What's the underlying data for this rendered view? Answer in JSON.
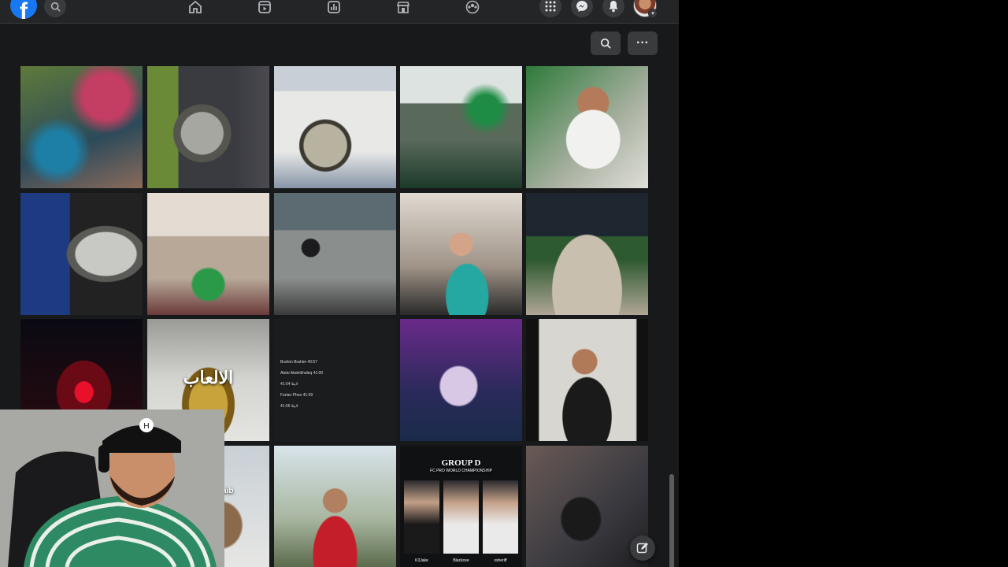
{
  "nav": {
    "logo_text": "f",
    "icons": [
      "search-icon",
      "home-icon",
      "reels-icon",
      "stats-icon",
      "marketplace-icon",
      "groups-icon",
      "apps-grid-icon",
      "messenger-icon",
      "bell-icon"
    ]
  },
  "toolbar": {
    "icons": [
      "search-icon",
      "more-icon"
    ],
    "more_label": "···"
  },
  "grid": {
    "rows": 4,
    "columns": 5,
    "captions": {
      "arabic_title": "الالعاب",
      "gamsi_handle": "gamsi choaib",
      "group_title": "GROUP D",
      "group_subtitle": "FC PRO WORLD CHAMPIONSHIP",
      "players": [
        "K3Jake",
        "Blackcee",
        "xsheriff"
      ],
      "chat_names": [
        "Brahim Brahim 40:57",
        "Abdo Abdelkhaleq 41:00",
        "لابيلا 41:04",
        "Forian Phoo 41:09",
        "لابيلا 41:06"
      ]
    }
  },
  "colors": {
    "facebook_blue": "#1877f2",
    "panel_bg": "#18191a",
    "topbar_bg": "#242526",
    "button_bg": "#3a3b3c"
  }
}
